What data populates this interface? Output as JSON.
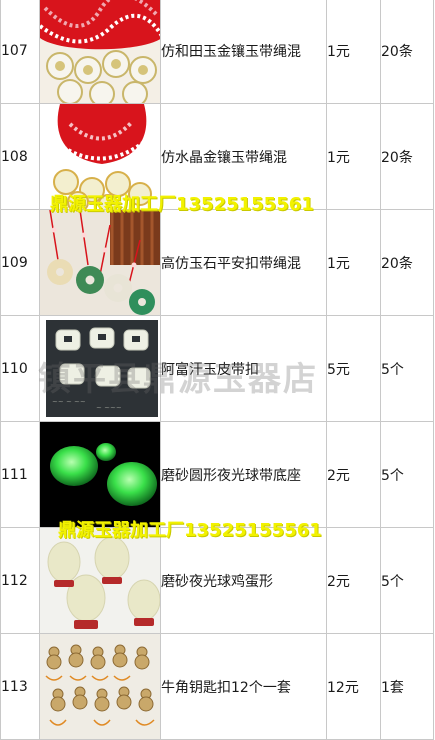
{
  "rows": [
    {
      "no": "107",
      "image": "white-jade-pendants-red-cord",
      "name": "仿和田玉金镶玉带绳混",
      "price": "1元",
      "qty": "20条"
    },
    {
      "no": "108",
      "image": "crystal-pendants-red-cord",
      "name": "仿水晶金镶玉带绳混",
      "price": "1元",
      "qty": "20条"
    },
    {
      "no": "109",
      "image": "jade-ping-an-buckle-necklaces",
      "name": "高仿玉石平安扣带绳混",
      "price": "1元",
      "qty": "20条"
    },
    {
      "no": "110",
      "image": "afghan-jade-belt-buckles",
      "name": "阿富汗玉皮带扣",
      "price": "5元",
      "qty": "5个"
    },
    {
      "no": "111",
      "image": "glowing-round-stones",
      "name": "磨砂圆形夜光球带底座",
      "price": "2元",
      "qty": "5个"
    },
    {
      "no": "112",
      "image": "frosted-egg-glow-balls",
      "name": "磨砂夜光球鸡蛋形",
      "price": "2元",
      "qty": "5个"
    },
    {
      "no": "113",
      "image": "horn-gourd-keychains",
      "name": "牛角钥匙扣12个一套",
      "price": "12元",
      "qty": "1套"
    }
  ],
  "watermarks": {
    "yellow_1": "鼎源玉器加工厂13525155561",
    "yellow_2": "鼎源玉器加工厂13525155561",
    "grey": "镇平县鼎源玉器店"
  },
  "colors": {
    "border": "#c8c8c8",
    "watermark_yellow": "#f2f200",
    "cord_red": "#d8141c",
    "glow_green": "#36e04a"
  }
}
